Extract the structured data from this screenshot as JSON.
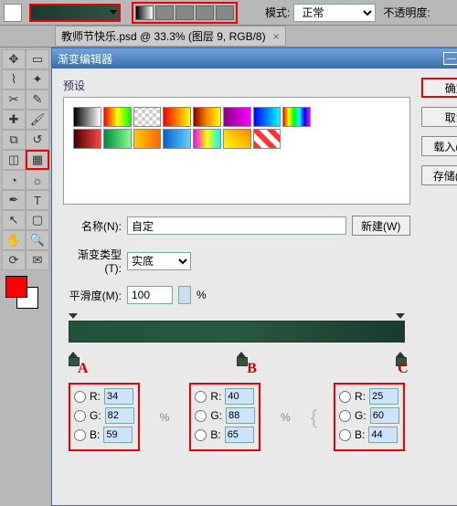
{
  "options": {
    "mode_label": "模式:",
    "mode_value": "正常",
    "opacity_label": "不透明度:"
  },
  "doc_tab": {
    "title": "教师节快乐.psd @ 33.3% (图层 9, RGB/8)",
    "close": "×"
  },
  "dialog": {
    "title": "渐变编辑器",
    "presets_label": "预设",
    "name_label": "名称(N):",
    "name_value": "自定",
    "type_label": "渐变类型(T):",
    "type_value": "实底",
    "smooth_label": "平滑度(M):",
    "smooth_value": "100",
    "percent": "%",
    "buttons": {
      "ok": "确定",
      "cancel": "取消",
      "load": "载入(L)...",
      "save": "存储(S)...",
      "new": "新建(W)"
    },
    "marks": {
      "a": "A",
      "b": "B",
      "c": "C"
    },
    "rgb": {
      "a": {
        "r": "34",
        "g": "82",
        "b": "59"
      },
      "b": {
        "r": "40",
        "g": "88",
        "b": "65"
      },
      "c": {
        "r": "25",
        "g": "60",
        "b": "44"
      }
    },
    "labels": {
      "r": "R:",
      "g": "G:",
      "b": "B:"
    }
  },
  "presets_colors": [
    "linear-gradient(90deg,#000,#fff)",
    "linear-gradient(90deg,#f00,#ff0,#0f0)",
    "repeating-conic-gradient(#ccc 0 25%,#fff 0 50%) 0/8px 8px",
    "linear-gradient(90deg,#f00,#ff0)",
    "linear-gradient(90deg,#800,#f80,#ff0)",
    "linear-gradient(90deg,#808,#f0f)",
    "linear-gradient(90deg,#00f,#0ff)",
    "linear-gradient(90deg,#f00,#ff0,#0f0,#0ff,#00f,#f0f)",
    "linear-gradient(90deg,#400,#f44)",
    "linear-gradient(90deg,#084,#8f8)",
    "linear-gradient(90deg,#fc0,#f60)",
    "linear-gradient(90deg,#06c,#6cf)",
    "linear-gradient(90deg,#f0f,#ff0,#0ff)",
    "linear-gradient(45deg,#ff0,#f80)",
    "repeating-linear-gradient(45deg,#f33 0 6px,#fff 6px 12px)",
    ""
  ]
}
